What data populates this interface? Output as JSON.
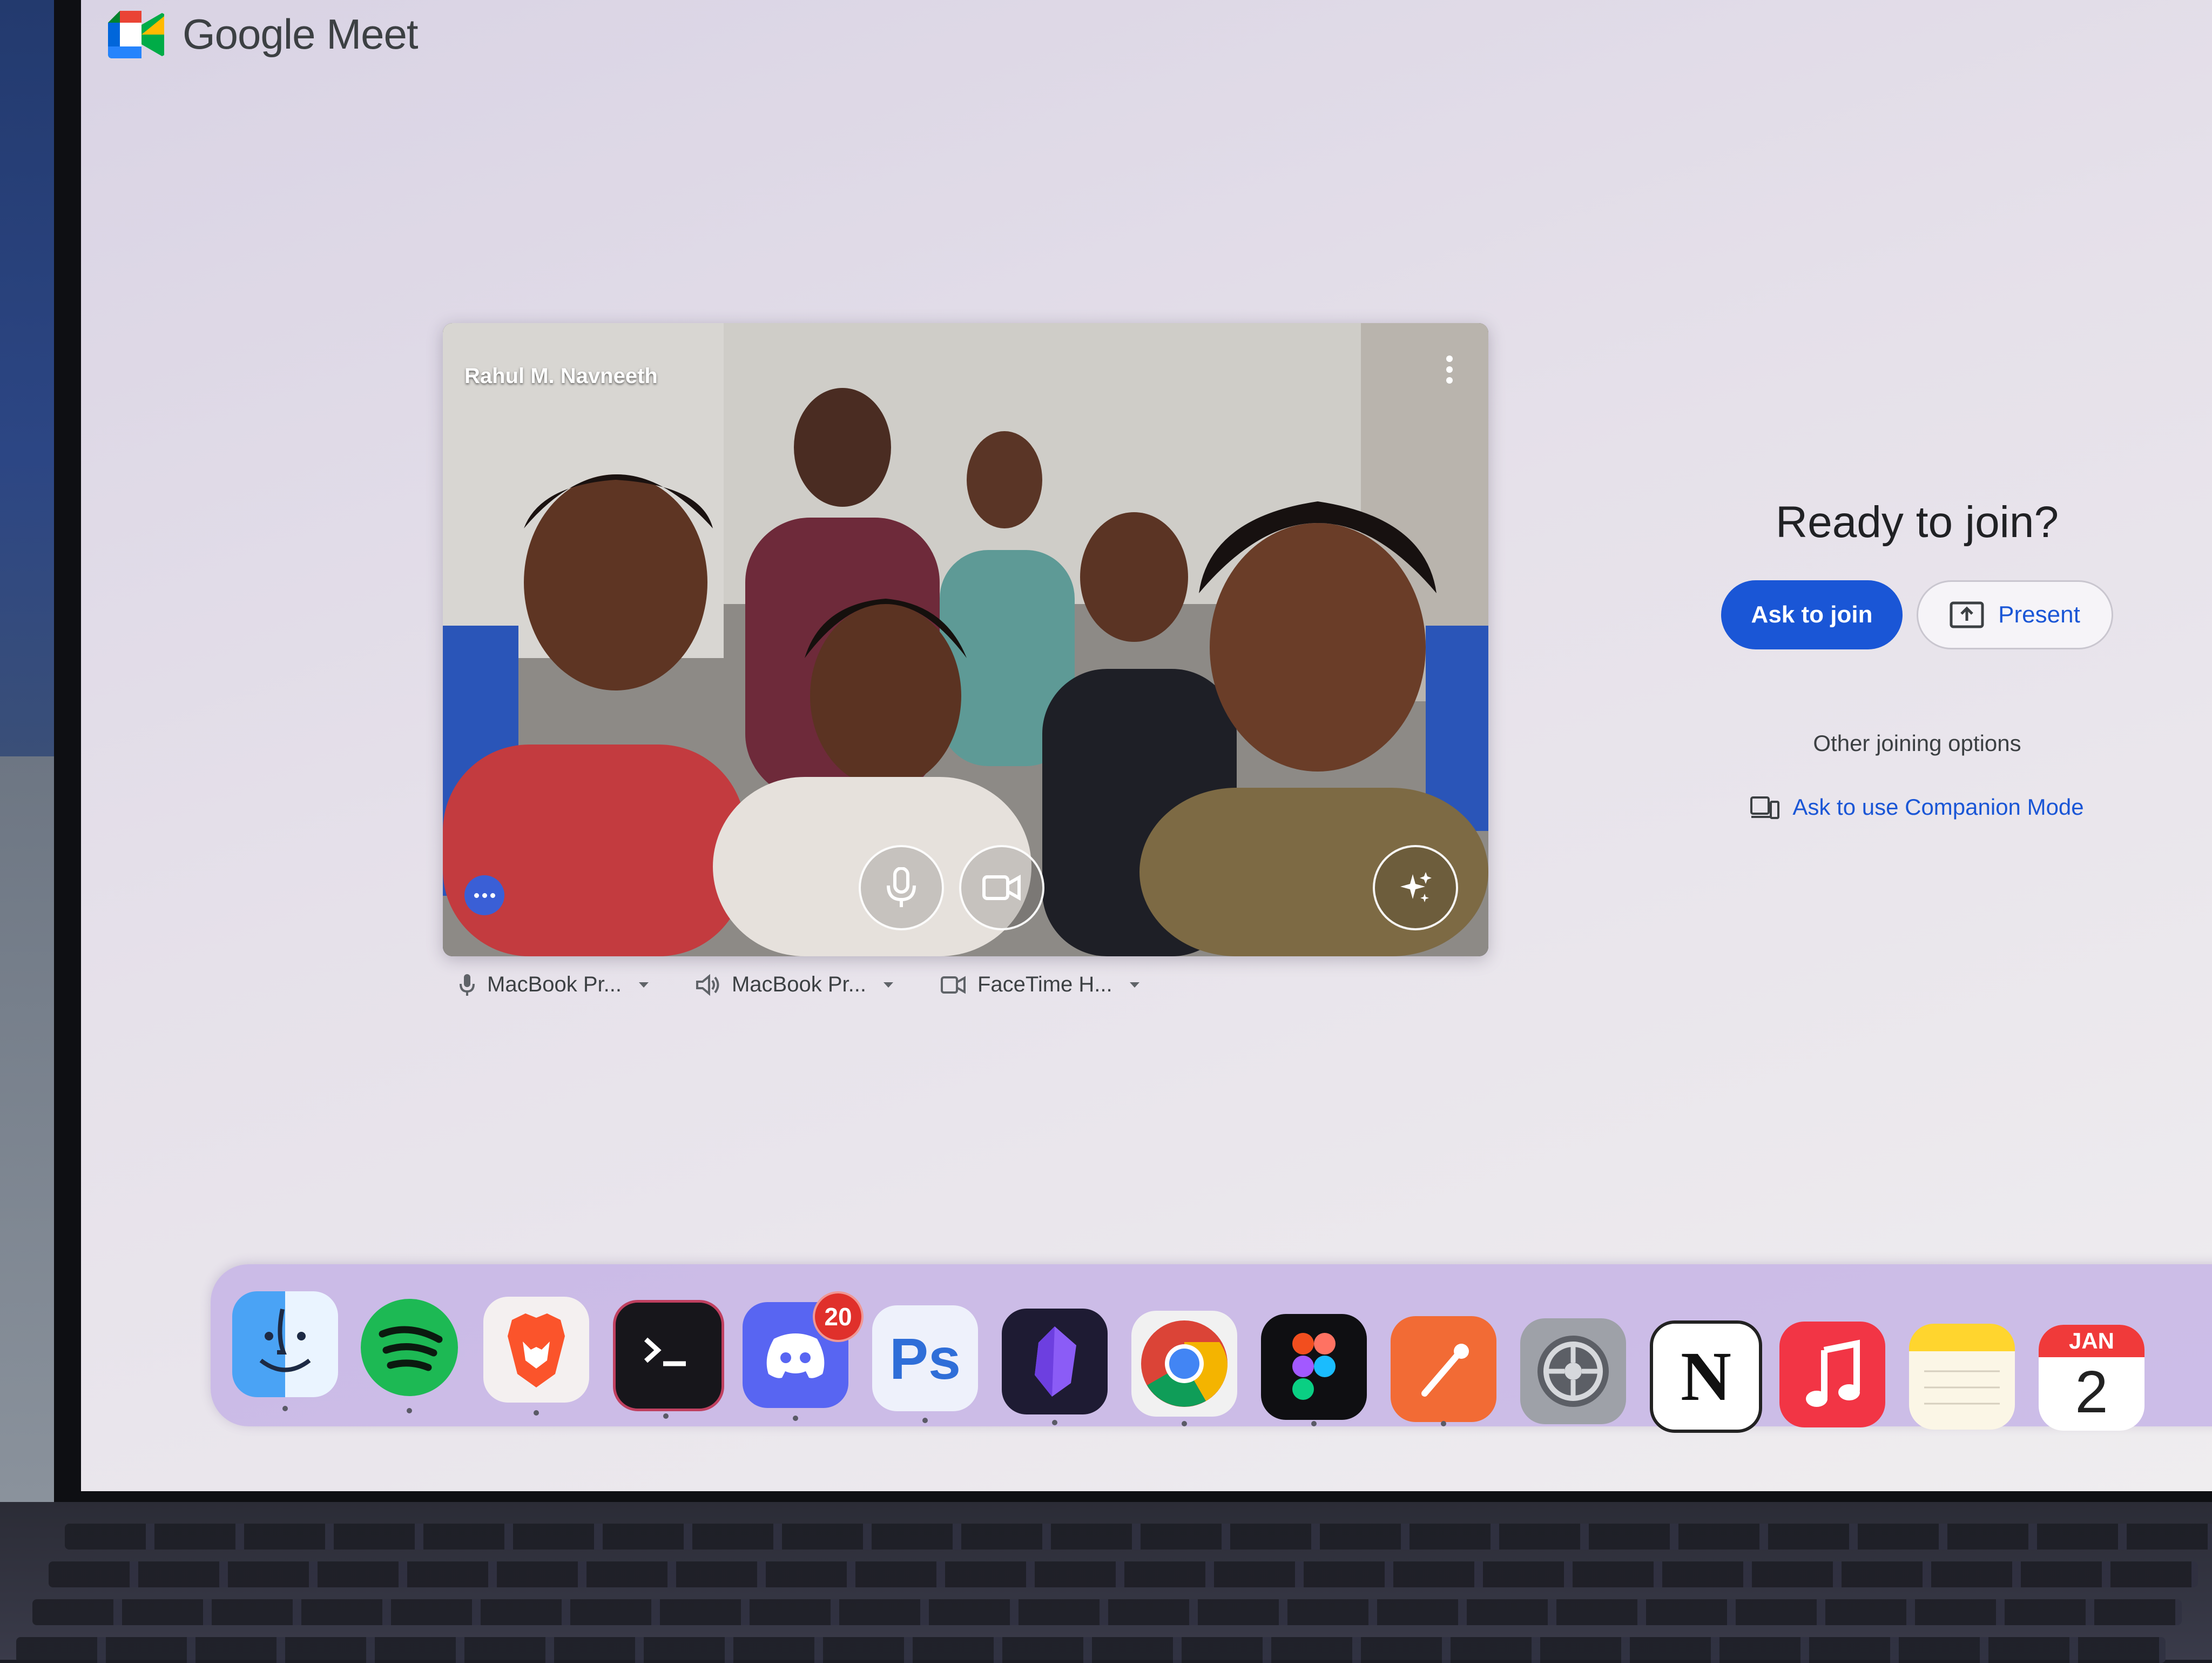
{
  "app": {
    "name": "Google Meet"
  },
  "preview": {
    "participant_name": "Rahul M. Navneeth",
    "mic_icon": "mic-icon",
    "camera_icon": "videocam-icon",
    "effects_icon": "sparkle-effects-icon",
    "more_icon": "more-vert-icon"
  },
  "devices": [
    {
      "icon": "mic-icon",
      "label": "MacBook Pr..."
    },
    {
      "icon": "speaker-icon",
      "label": "MacBook Pr..."
    },
    {
      "icon": "videocam-icon",
      "label": "FaceTime H..."
    }
  ],
  "join": {
    "title": "Ready to join?",
    "ask_label": "Ask to join",
    "present_label": "Present",
    "other_options": "Other joining options",
    "companion_label": "Ask to use Companion Mode"
  },
  "dock": {
    "apps": [
      {
        "name": "Finder",
        "icon": "finder-icon"
      },
      {
        "name": "Spotify",
        "icon": "spotify-icon"
      },
      {
        "name": "Brave",
        "icon": "brave-icon"
      },
      {
        "name": "Terminal",
        "icon": "terminal-icon"
      },
      {
        "name": "Discord",
        "icon": "discord-icon",
        "badge": "20"
      },
      {
        "name": "Photoshop",
        "icon": "photoshop-icon",
        "label": "Ps"
      },
      {
        "name": "Obsidian",
        "icon": "obsidian-icon"
      },
      {
        "name": "Chrome",
        "icon": "chrome-icon"
      },
      {
        "name": "Figma",
        "icon": "figma-icon"
      },
      {
        "name": "Postman",
        "icon": "postman-icon"
      },
      {
        "name": "System Settings",
        "icon": "settings-icon"
      },
      {
        "name": "Notion",
        "icon": "notion-icon",
        "label": "N"
      },
      {
        "name": "Music",
        "icon": "music-icon"
      },
      {
        "name": "Notes",
        "icon": "notes-icon"
      },
      {
        "name": "Calendar",
        "icon": "calendar-icon",
        "month": "JAN",
        "day": "2"
      }
    ]
  },
  "colors": {
    "accent": "#1a56d6",
    "discord_badge": "#e0302b"
  }
}
